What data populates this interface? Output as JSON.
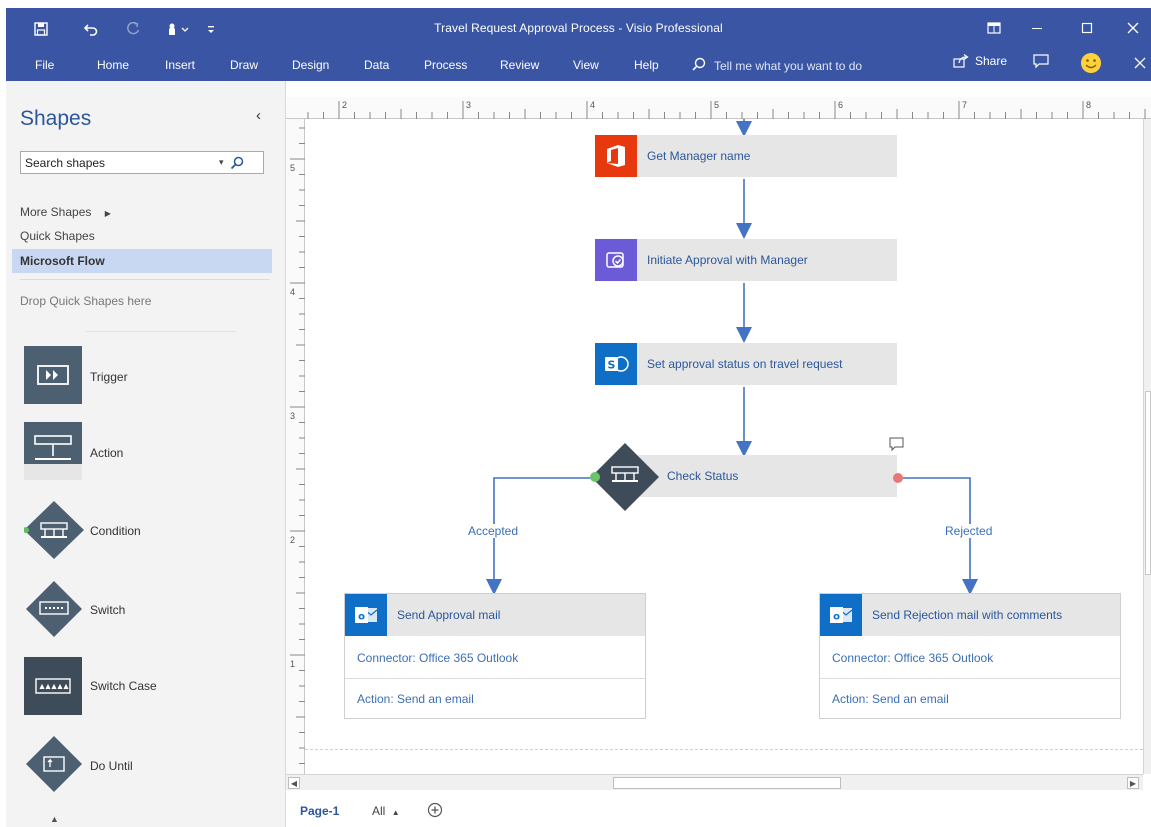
{
  "window": {
    "title": "Travel Request Approval Process  -  Visio Professional"
  },
  "ribbon": {
    "tabs": [
      "File",
      "Home",
      "Insert",
      "Draw",
      "Design",
      "Data",
      "Process",
      "Review",
      "View",
      "Help"
    ],
    "tell_me": "Tell me what you want to do",
    "share": "Share"
  },
  "shapes_pane": {
    "title": "Shapes",
    "search_placeholder": "Search shapes",
    "search_value": "Search shapes",
    "more_shapes": "More Shapes",
    "quick_shapes": "Quick Shapes",
    "selected_stencil": "Microsoft Flow",
    "drop_hint": "Drop Quick Shapes here",
    "stencils": [
      "Trigger",
      "Action",
      "Condition",
      "Switch",
      "Switch Case",
      "Do Until"
    ]
  },
  "rulers": {
    "horizontal_ticks": [
      "2",
      "3",
      "4",
      "5",
      "6",
      "7",
      "8"
    ],
    "vertical_ticks": [
      "5",
      "4",
      "3",
      "2",
      "1"
    ]
  },
  "diagram": {
    "step1": "Get Manager name",
    "step2": "Initiate Approval with Manager",
    "step3": "Set approval status on travel request",
    "condition": "Check Status",
    "accepted_label": "Accepted",
    "rejected_label": "Rejected",
    "accepted_card": {
      "title": "Send Approval mail",
      "connector": "Connector: Office 365 Outlook",
      "action": "Action: Send an email"
    },
    "rejected_card": {
      "title": "Send Rejection mail with comments",
      "connector": "Connector: Office 365 Outlook",
      "action": "Action: Send an email"
    }
  },
  "page_tabs": {
    "current": "Page-1",
    "all": "All"
  },
  "colors": {
    "ribbon": "#3955a3",
    "office_red": "#e8390e",
    "approvals_purple": "#6b5bd6",
    "sharepoint_blue": "#0f6fc6",
    "connector_blue": "#4472c4",
    "accent_text": "#2b579a"
  },
  "icons": [
    "save-icon",
    "undo-icon",
    "redo-icon",
    "touch-icon",
    "customize-icon",
    "ribbon-display-icon",
    "minimize-icon",
    "maximize-icon",
    "close-icon",
    "search-icon",
    "share-icon",
    "comment-icon",
    "smiley-icon",
    "add-page-icon"
  ]
}
